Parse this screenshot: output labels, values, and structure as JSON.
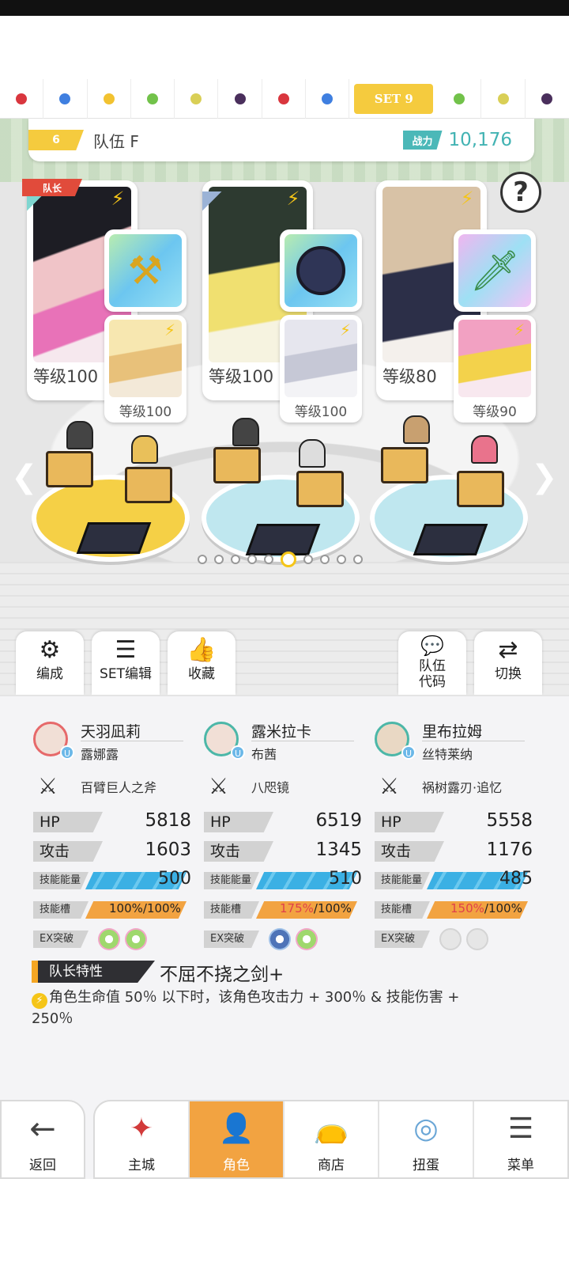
{
  "set_tabs": {
    "dots": [
      "#d9363e",
      "#3f7fe0",
      "#f2c230",
      "#72c24a",
      "#d9cf56",
      "#4a2f5c",
      "#d9363e",
      "#3f7fe0"
    ],
    "active_label": "SET 9",
    "dots_after": [
      "#72c24a",
      "#d9cf56",
      "#4a2f5c"
    ]
  },
  "team": {
    "number": "6",
    "name": "队伍 F",
    "power_label": "战力",
    "power_value": "10,176"
  },
  "help_label": "?",
  "leader_badge": "队长",
  "heroes": [
    {
      "level": "等级100",
      "sub_level": "等级100"
    },
    {
      "level": "等级100",
      "sub_level": "等级100"
    },
    {
      "level": "等级80",
      "sub_level": "等级90"
    }
  ],
  "actions": {
    "formation": "编成",
    "set_edit": "SET编辑",
    "favorite": "收藏",
    "team_code_line1": "队伍",
    "team_code_line2": "代码",
    "switch": "切换"
  },
  "info": [
    {
      "name": "天羽凪莉",
      "sub": "露娜露",
      "weapon": "百臂巨人之斧",
      "hp_label": "HP",
      "hp": "5818",
      "atk_label": "攻击",
      "atk": "1603",
      "energy_label": "技能能量",
      "energy": "500",
      "slot_label": "技能槽",
      "slot_cur": "100",
      "slot_max": "100",
      "ex_label": "EX突破"
    },
    {
      "name": "露米拉卡",
      "sub": "布茜",
      "weapon": "八咫镜",
      "hp_label": "HP",
      "hp": "6519",
      "atk_label": "攻击",
      "atk": "1345",
      "energy_label": "技能能量",
      "energy": "510",
      "slot_label": "技能槽",
      "slot_cur": "175",
      "slot_max": "100",
      "ex_label": "EX突破"
    },
    {
      "name": "里布拉姆",
      "sub": "丝特莱纳",
      "weapon": "祸树露刃·追忆",
      "hp_label": "HP",
      "hp": "5558",
      "atk_label": "攻击",
      "atk": "1176",
      "energy_label": "技能能量",
      "energy": "485",
      "slot_label": "技能槽",
      "slot_cur": "150",
      "slot_max": "100",
      "ex_label": "EX突破"
    }
  ],
  "percent_sign": "%",
  "leader_trait": {
    "tag": "队长特性",
    "title": "不屈不挠之剑+",
    "desc": "角色生命值 50％ 以下时，该角色攻击力 + 300％ & 技能伤害 + 250％"
  },
  "nav": {
    "back": "返回",
    "main_city": "主城",
    "character": "角色",
    "shop": "商店",
    "gacha": "扭蛋",
    "menu": "菜单"
  }
}
